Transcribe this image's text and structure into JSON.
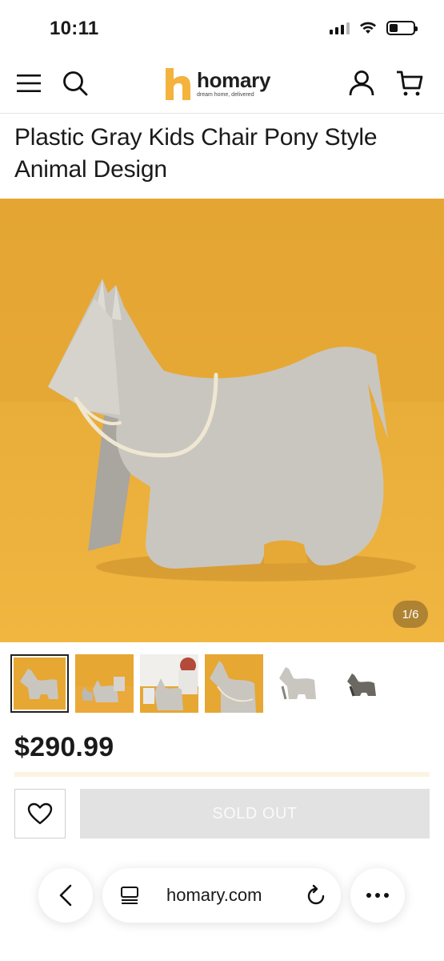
{
  "status_bar": {
    "time": "10:11"
  },
  "header": {
    "logo_name": "homary",
    "logo_tagline": "dream home, delivered"
  },
  "product": {
    "title": "Plastic Gray Kids Chair Pony Style Animal Design",
    "image_counter": "1/6",
    "price": "$290.99",
    "thumbnail_count": 6,
    "active_thumbnail": 1
  },
  "actions": {
    "sold_out_label": "SOLD OUT"
  },
  "browser": {
    "url": "homary.com"
  },
  "colors": {
    "hero_background": "#e6a733",
    "logo_accent": "#f3b33d",
    "sold_out_bg": "#e2e2e2",
    "pony_gray": "#c9c6c0"
  }
}
